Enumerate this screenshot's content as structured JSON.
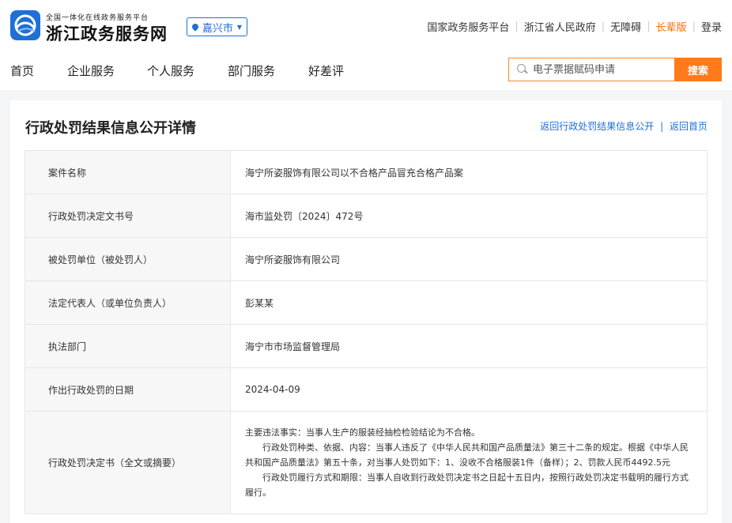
{
  "header": {
    "logo_sub": "全国一体化在线政务服务平台",
    "logo_main": "浙江政务服务网",
    "city": "嘉兴市",
    "links": [
      "国家政务服务平台",
      "浙江省人民政府",
      "无障碍",
      "长辈版",
      "登录"
    ]
  },
  "nav": {
    "items": [
      "首页",
      "企业服务",
      "个人服务",
      "部门服务",
      "好差评"
    ],
    "search_placeholder": "电子票据赋码申请",
    "search_button": "搜索"
  },
  "page": {
    "title": "行政处罚结果信息公开详情",
    "back_list": "返回行政处罚结果信息公开",
    "back_home": "返回首页",
    "separator": "|"
  },
  "details": {
    "rows": [
      {
        "label": "案件名称",
        "value": "海宁所姿服饰有限公司以不合格产品冒充合格产品案"
      },
      {
        "label": "行政处罚决定文书号",
        "value": "海市监处罚〔2024〕472号"
      },
      {
        "label": "被处罚单位（被处罚人）",
        "value": "海宁所姿服饰有限公司"
      },
      {
        "label": "法定代表人（或单位负责人）",
        "value": "彭某某"
      },
      {
        "label": "执法部门",
        "value": "海宁市市场监督管理局"
      },
      {
        "label": "作出行政处罚的日期",
        "value": "2024-04-09"
      }
    ],
    "decision": {
      "label": "行政处罚决定书（全文或摘要）",
      "line1": "主要违法事实：当事人生产的服装经抽检检验结论为不合格。",
      "line2": "行政处罚种类、依据、内容：当事人违反了《中华人民共和国产品质量法》第三十二条的规定。根据《中华人民共和国产品质量法》第五十条，对当事人处罚如下：1、没收不合格服装1件（备样）；2、罚款人民币4492.5元",
      "line3": "行政处罚履行方式和期限：当事人自收到行政处罚决定书之日起十五日内，按照行政处罚决定书载明的履行方式履行。"
    }
  },
  "colors": {
    "brand_blue": "#1f6fd6",
    "accent_orange": "#ff7a1a"
  }
}
